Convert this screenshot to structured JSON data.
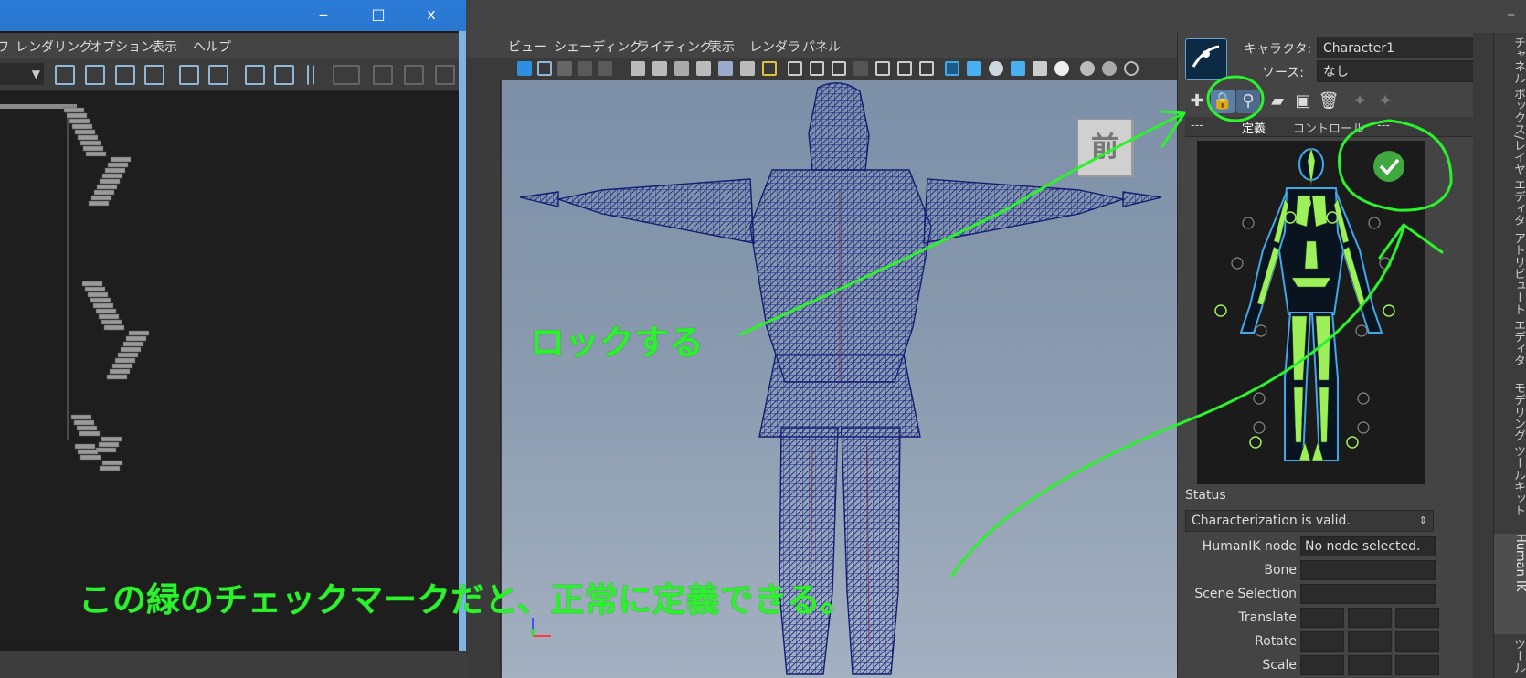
{
  "left_window": {
    "title_buttons": {
      "minimize": "‒",
      "maximize": "□",
      "close": "x"
    },
    "menu": [
      "ワ",
      "レンダリング",
      "オプション",
      "表示",
      "ヘルプ"
    ]
  },
  "viewport": {
    "menu": [
      "ビュー",
      "シェーディング",
      "ライティング",
      "表示",
      "レンダラ",
      "パネル"
    ],
    "viewcube_label": "前"
  },
  "hik": {
    "character_label": "キャラクタ:",
    "character_value": "Character1",
    "source_label": "ソース:",
    "source_value": "なし",
    "tabs": [
      "---",
      "定義",
      "コントロール",
      "---"
    ],
    "status_header": "Status",
    "status_value": "Characterization is valid.",
    "fields": [
      {
        "label": "HumanIK node",
        "value": "No node selected."
      },
      {
        "label": "Bone",
        "value": ""
      },
      {
        "label": "Scene Selection",
        "value": ""
      },
      {
        "label": "Translate",
        "value": ""
      },
      {
        "label": "Rotate",
        "value": ""
      },
      {
        "label": "Scale",
        "value": ""
      }
    ],
    "accent_color": "#9ef05a"
  },
  "side_tabs": [
    "チャネル ボックス/レイヤ エディタ",
    "アトリビュート エディタ",
    "モデリング ツールキット",
    "Human IK",
    "ツール"
  ],
  "annotations": {
    "lock": "ロックする",
    "checkmark": "この緑のチェックマークだと、正常に定義できる。",
    "color": "#2bf22b"
  }
}
